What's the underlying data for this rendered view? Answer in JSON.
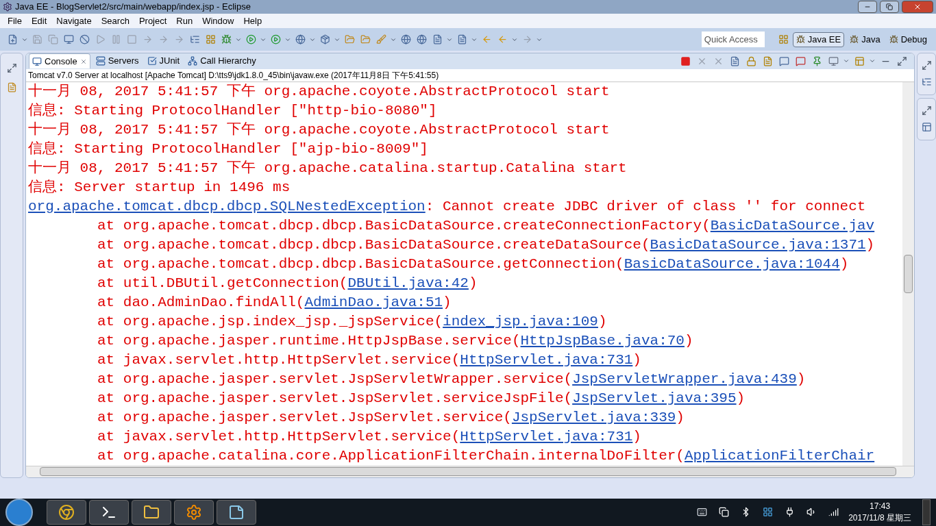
{
  "window": {
    "title": "Java EE - BlogServlet2/src/main/webapp/index.jsp - Eclipse"
  },
  "menu": [
    "File",
    "Edit",
    "Navigate",
    "Search",
    "Project",
    "Run",
    "Window",
    "Help"
  ],
  "quick_access": {
    "placeholder": "Quick Access"
  },
  "perspectives": [
    {
      "label": "Java EE",
      "selected": true
    },
    {
      "label": "Java",
      "selected": false
    },
    {
      "label": "Debug",
      "selected": false
    }
  ],
  "view_tabs": [
    {
      "label": "Console",
      "selected": true
    },
    {
      "label": "Servers",
      "selected": false
    },
    {
      "label": "JUnit",
      "selected": false
    },
    {
      "label": "Call Hierarchy",
      "selected": false
    }
  ],
  "console": {
    "description": "Tomcat v7.0 Server at localhost [Apache Tomcat] D:\\tts9\\jdk1.8.0_45\\bin\\javaw.exe (2017年11月8日 下午5:41:55)",
    "lines": [
      {
        "kind": "log",
        "text": "十一月 08, 2017 5:41:57 下午 org.apache.coyote.AbstractProtocol start"
      },
      {
        "kind": "log",
        "text": "信息: Starting ProtocolHandler [\"http-bio-8080\"]"
      },
      {
        "kind": "log",
        "text": "十一月 08, 2017 5:41:57 下午 org.apache.coyote.AbstractProtocol start"
      },
      {
        "kind": "log",
        "text": "信息: Starting ProtocolHandler [\"ajp-bio-8009\"]"
      },
      {
        "kind": "log",
        "text": "十一月 08, 2017 5:41:57 下午 org.apache.catalina.startup.Catalina start"
      },
      {
        "kind": "log",
        "text": "信息: Server startup in 1496 ms"
      },
      {
        "kind": "exception",
        "link": "org.apache.tomcat.dbcp.dbcp.SQLNestedException",
        "text": ": Cannot create JDBC driver of class '' for connect"
      },
      {
        "kind": "trace",
        "text": "at org.apache.tomcat.dbcp.dbcp.BasicDataSource.createConnectionFactory(",
        "link": "BasicDataSource.jav"
      },
      {
        "kind": "trace",
        "text": "at org.apache.tomcat.dbcp.dbcp.BasicDataSource.createDataSource(",
        "link": "BasicDataSource.java:1371",
        "end": ")"
      },
      {
        "kind": "trace",
        "text": "at org.apache.tomcat.dbcp.dbcp.BasicDataSource.getConnection(",
        "link": "BasicDataSource.java:1044",
        "end": ")"
      },
      {
        "kind": "trace",
        "text": "at util.DBUtil.getConnection(",
        "link": "DBUtil.java:42",
        "end": ")"
      },
      {
        "kind": "trace",
        "text": "at dao.AdminDao.findAll(",
        "link": "AdminDao.java:51",
        "end": ")"
      },
      {
        "kind": "trace",
        "text": "at org.apache.jsp.index_jsp._jspService(",
        "link": "index_jsp.java:109",
        "end": ")"
      },
      {
        "kind": "trace",
        "text": "at org.apache.jasper.runtime.HttpJspBase.service(",
        "link": "HttpJspBase.java:70",
        "end": ")"
      },
      {
        "kind": "trace",
        "text": "at javax.servlet.http.HttpServlet.service(",
        "link": "HttpServlet.java:731",
        "end": ")"
      },
      {
        "kind": "trace",
        "text": "at org.apache.jasper.servlet.JspServletWrapper.service(",
        "link": "JspServletWrapper.java:439",
        "end": ")"
      },
      {
        "kind": "trace",
        "text": "at org.apache.jasper.servlet.JspServlet.serviceJspFile(",
        "link": "JspServlet.java:395",
        "end": ")"
      },
      {
        "kind": "trace",
        "text": "at org.apache.jasper.servlet.JspServlet.service(",
        "link": "JspServlet.java:339",
        "end": ")"
      },
      {
        "kind": "trace",
        "text": "at javax.servlet.http.HttpServlet.service(",
        "link": "HttpServlet.java:731",
        "end": ")"
      },
      {
        "kind": "trace",
        "text": "at org.apache.catalina.core.ApplicationFilterChain.internalDoFilter(",
        "link": "ApplicationFilterChair"
      }
    ]
  },
  "taskbar": {
    "time": "17:43",
    "date": "2017/11/8 星期三"
  }
}
